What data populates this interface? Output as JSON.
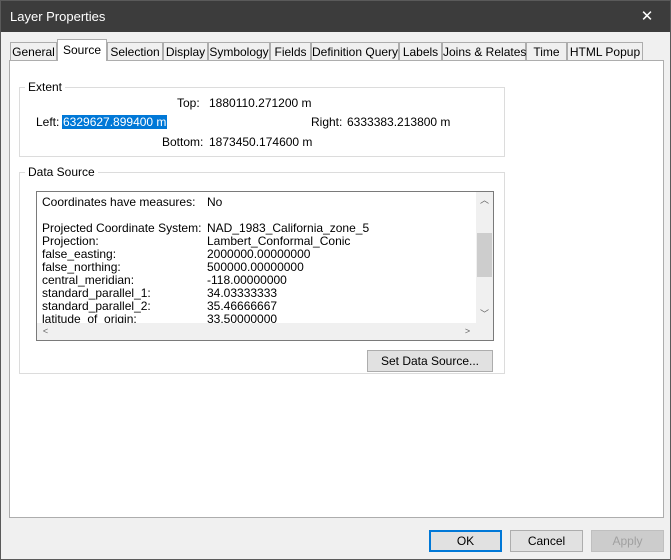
{
  "window": {
    "title": "Layer Properties",
    "close_glyph": "✕"
  },
  "tabs": [
    {
      "label": "General"
    },
    {
      "label": "Source"
    },
    {
      "label": "Selection"
    },
    {
      "label": "Display"
    },
    {
      "label": "Symbology"
    },
    {
      "label": "Fields"
    },
    {
      "label": "Definition Query"
    },
    {
      "label": "Labels"
    },
    {
      "label": "Joins & Relates"
    },
    {
      "label": "Time"
    },
    {
      "label": "HTML Popup"
    }
  ],
  "active_tab": "Source",
  "extent": {
    "legend": "Extent",
    "top_label": "Top:",
    "top_value": "1880110.271200 m",
    "left_label": "Left:",
    "left_value": "6329627.899400 m",
    "right_label": "Right:",
    "right_value": "6333383.213800 m",
    "bottom_label": "Bottom:",
    "bottom_value": "1873450.174600 m"
  },
  "data_source": {
    "legend": "Data Source",
    "rows": [
      {
        "key": "Coordinates have measures:",
        "value": "No"
      },
      {
        "key": "",
        "value": ""
      },
      {
        "key": "Projected Coordinate System:",
        "value": "NAD_1983_California_zone_5"
      },
      {
        "key": "Projection:",
        "value": "Lambert_Conformal_Conic"
      },
      {
        "key": "false_easting:",
        "value": "2000000.00000000"
      },
      {
        "key": "false_northing:",
        "value": "500000.00000000"
      },
      {
        "key": "central_meridian:",
        "value": "-118.00000000"
      },
      {
        "key": "standard_parallel_1:",
        "value": "34.03333333"
      },
      {
        "key": "standard_parallel_2:",
        "value": "35.46666667"
      },
      {
        "key": "latitude_of_origin:",
        "value": "33.50000000"
      }
    ],
    "set_button": "Set Data Source..."
  },
  "footer": {
    "ok": "OK",
    "cancel": "Cancel",
    "apply": "Apply"
  },
  "colors": {
    "titlebar": "#3c3c3c",
    "selection": "#0078d7"
  },
  "icons": {
    "scroll_up": "up-arrow-icon",
    "scroll_down": "down-arrow-icon",
    "scroll_left": "left-arrow-icon",
    "scroll_right": "right-arrow-icon"
  }
}
